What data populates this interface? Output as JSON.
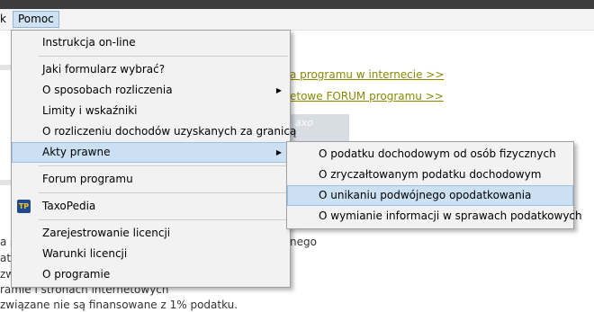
{
  "menubar": {
    "partial_left": "k",
    "help": "Pomoc"
  },
  "background": {
    "link1": "a programu w internecie >>",
    "link2": "etowe FORUM programu >>",
    "logo_text": "axo",
    "text_ngego": "nego",
    "text_a_s": "a s",
    "text_atk": "atk",
    "text_zw": "zw",
    "text_line1": "ramie i stronach internetowych",
    "text_line2": "związane nie są finansowane z 1% podatku."
  },
  "help_menu": {
    "items": [
      {
        "label": "Instrukcja on-line"
      },
      {
        "label": "Jaki formularz wybrać?"
      },
      {
        "label": "O sposobach rozliczenia"
      },
      {
        "label": "Limity i wskaźniki"
      },
      {
        "label": "O rozliczeniu dochodów uzyskanych za granicą"
      },
      {
        "label": "Akty prawne"
      },
      {
        "label": "Forum programu"
      },
      {
        "label": "TaxoPedia"
      },
      {
        "label": "Zarejestrowanie licencji"
      },
      {
        "label": "Warunki licencji"
      },
      {
        "label": "O programie"
      }
    ],
    "taxopedia_icon_text": "TP"
  },
  "submenu": {
    "items": [
      {
        "label": "O podatku dochodowym od osób fizycznych"
      },
      {
        "label": "O zryczałtowanym podatku dochodowym"
      },
      {
        "label": "O unikaniu podwójnego opodatkowania"
      },
      {
        "label": "O wymianie informacji w sprawach podatkowych"
      }
    ]
  }
}
